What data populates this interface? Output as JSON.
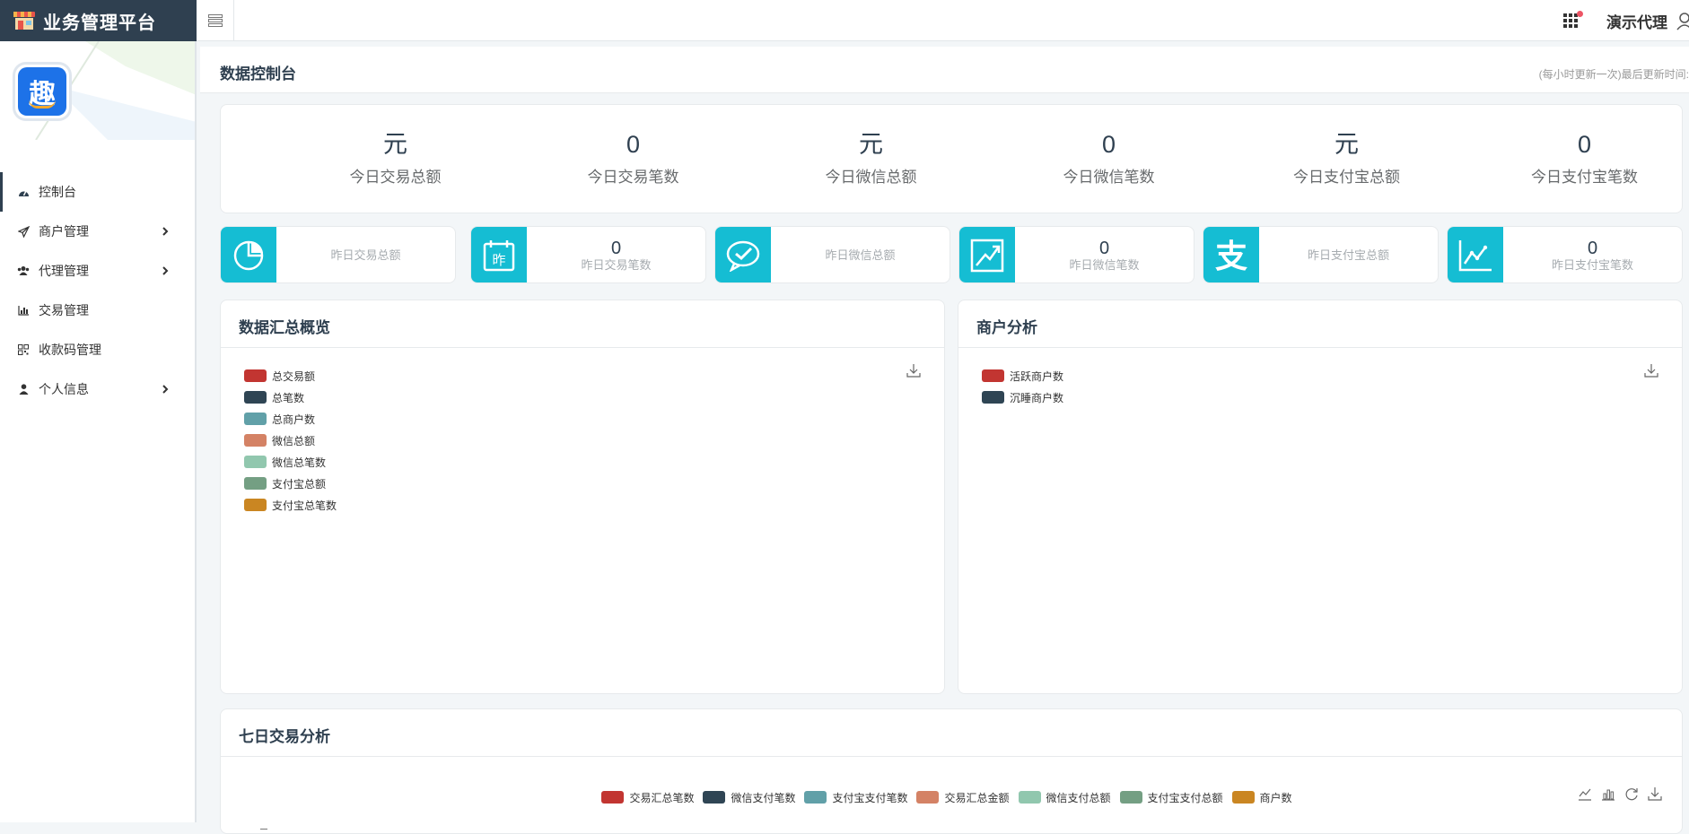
{
  "app": {
    "title": "业务管理平台"
  },
  "topbar": {
    "username": "演示代理"
  },
  "sidebar": {
    "logo_char": "趣",
    "items": [
      {
        "label": "控制台",
        "icon": "dashboard-icon",
        "active": true,
        "has_arrow": false
      },
      {
        "label": "商户管理",
        "icon": "paper-plane-icon",
        "has_arrow": true
      },
      {
        "label": "代理管理",
        "icon": "users-icon",
        "has_arrow": true
      },
      {
        "label": "交易管理",
        "icon": "bar-chart-icon",
        "has_arrow": false
      },
      {
        "label": "收款码管理",
        "icon": "qrcode-icon",
        "has_arrow": false
      },
      {
        "label": "个人信息",
        "icon": "user-icon",
        "has_arrow": true
      }
    ]
  },
  "page": {
    "title": "数据控制台",
    "note": "(每小时更新一次)最后更新时间:"
  },
  "today_stats": [
    {
      "value": "元",
      "label": "今日交易总额"
    },
    {
      "value": "0",
      "label": "今日交易笔数"
    },
    {
      "value": "元",
      "label": "今日微信总额"
    },
    {
      "value": "0",
      "label": "今日微信笔数"
    },
    {
      "value": "元",
      "label": "今日支付宝总额"
    },
    {
      "value": "0",
      "label": "今日支付宝笔数"
    }
  ],
  "yesterday_stats": [
    {
      "value": "",
      "label": "昨日交易总额",
      "icon": "pie-chart-icon"
    },
    {
      "value": "0",
      "label": "昨日交易笔数",
      "icon": "calendar-icon",
      "icon_text": "昨"
    },
    {
      "value": "",
      "label": "昨日微信总额",
      "icon": "wechat-icon"
    },
    {
      "value": "0",
      "label": "昨日微信笔数",
      "icon": "trend-chart-icon"
    },
    {
      "value": "",
      "label": "昨日支付宝总额",
      "icon": "alipay-icon",
      "icon_text": "支"
    },
    {
      "value": "0",
      "label": "昨日支付宝笔数",
      "icon": "line-chart-icon"
    }
  ],
  "summary_panel": {
    "title": "数据汇总概览",
    "legend": [
      {
        "name": "总交易额",
        "color": "#c23531"
      },
      {
        "name": "总笔数",
        "color": "#2f4554"
      },
      {
        "name": "总商户数",
        "color": "#61a0a8"
      },
      {
        "name": "微信总额",
        "color": "#d48265"
      },
      {
        "name": "微信总笔数",
        "color": "#91c7ae"
      },
      {
        "name": "支付宝总额",
        "color": "#749f83"
      },
      {
        "name": "支付宝总笔数",
        "color": "#ca8622"
      }
    ]
  },
  "merchant_panel": {
    "title": "商户分析",
    "legend": [
      {
        "name": "活跃商户数",
        "color": "#c23531"
      },
      {
        "name": "沉睡商户数",
        "color": "#2f4554"
      }
    ]
  },
  "week_panel": {
    "title": "七日交易分析",
    "legend": [
      {
        "name": "交易汇总笔数",
        "color": "#c23531"
      },
      {
        "name": "微信支付笔数",
        "color": "#2f4554"
      },
      {
        "name": "支付宝支付笔数",
        "color": "#61a0a8"
      },
      {
        "name": "交易汇总金额",
        "color": "#d48265"
      },
      {
        "name": "微信支付总额",
        "color": "#91c7ae"
      },
      {
        "name": "支付宝支付总额",
        "color": "#749f83"
      },
      {
        "name": "商户数",
        "color": "#ca8622"
      }
    ]
  },
  "colors": {
    "sidebar_dark": "#2f4050",
    "accent": "#15bdd3",
    "notification": "#ed5565"
  }
}
